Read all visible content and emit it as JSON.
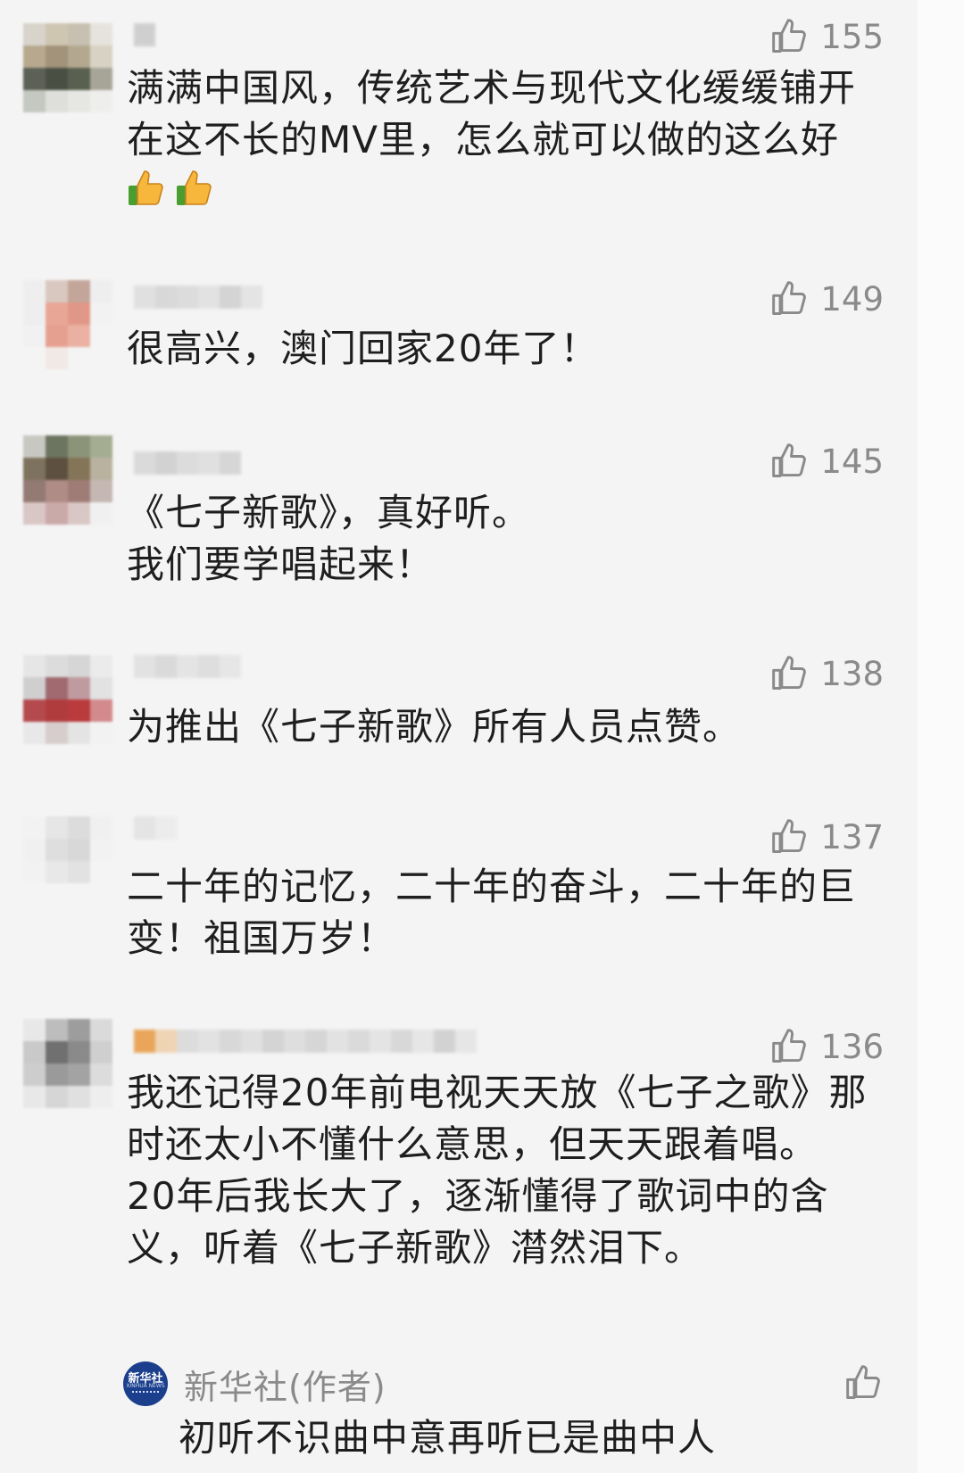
{
  "comments": [
    {
      "likes": "155",
      "text": "满满中国风，传统艺术与现代文化缓缓铺开\n在这不长的MV里，怎么就可以做的这么好",
      "emoji": [
        "thumbs-up-icon",
        "thumbs-up-icon"
      ]
    },
    {
      "likes": "149",
      "text": "很高兴，澳门回家20年了！"
    },
    {
      "likes": "145",
      "text": "《七子新歌》，真好听。\n我们要学唱起来！"
    },
    {
      "likes": "138",
      "text": "为推出《七子新歌》所有人员点赞。"
    },
    {
      "likes": "137",
      "text": "二十年的记忆，二十年的奋斗，二十年的巨\n变！祖国万岁！"
    },
    {
      "likes": "136",
      "text": "我还记得20年前电视天天放《七子之歌》那\n时还太小不懂什么意思，但天天跟着唱。\n20年后我长大了，逐渐懂得了歌词中的含\n义，听着《七子新歌》潸然泪下。"
    }
  ],
  "reply": {
    "author": "新华社(作者)",
    "avatar_text": "新华社",
    "avatar_subtext": "XINHUA NEWS",
    "text": "初听不识曲中意再听已是曲中人"
  },
  "colors": {
    "background": "#f4f4f4",
    "text": "#1e1e1e",
    "muted": "#8a8a8a",
    "xinhua_blue": "#1b3f8c"
  }
}
